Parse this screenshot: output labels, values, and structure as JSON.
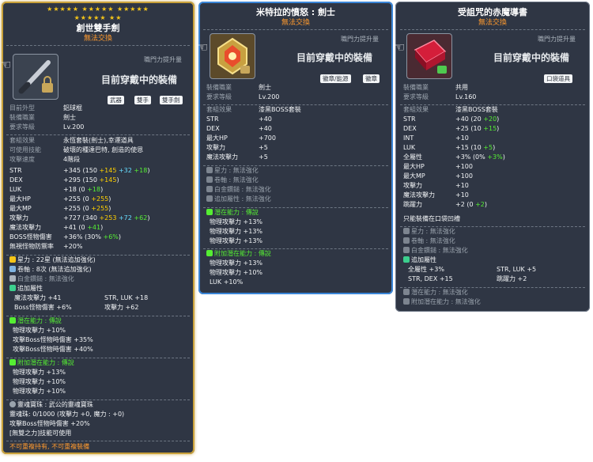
{
  "tip1": {
    "stars_row1": "★★★★★ ★★★★★ ★★★★★",
    "stars_row2": "★★★★★ ★★",
    "title": "創世雙手劍",
    "trade": "無法交換",
    "job_boost": "職門力提升量",
    "equipped": "目前穿戴中的裝備",
    "tags": [
      "武器",
      "雙手",
      "雙手劍"
    ],
    "look_label": "目前外型",
    "look_value": "鋁球棍",
    "job_label": "裝備職業",
    "job_value": "劍士",
    "req_label": "要求等級",
    "req_value": "Lv.200",
    "set_label": "套組效果",
    "set_value": "永恆套裝(劍士),幸運道具",
    "skill_label": "可使用技能",
    "skill_value": "破壞的種達巴特, 創造的使恩",
    "speed_label": "攻擊速度",
    "speed_value": "4階段",
    "stats": [
      {
        "label": "STR",
        "main": "+345 (150 ",
        "a": "+145",
        "b": " +32",
        "c": " +18",
        "end": ")"
      },
      {
        "label": "DEX",
        "main": "+295 (150 ",
        "a": "+145",
        "b": "",
        "c": "",
        "end": ")"
      },
      {
        "label": "LUK",
        "main": "+18 (0 ",
        "a": "",
        "b": "",
        "c": "+18",
        "end": ")"
      },
      {
        "label": "最大HP",
        "main": "+255 (0 ",
        "a": "+255",
        "b": "",
        "c": "",
        "end": ")"
      },
      {
        "label": "最大MP",
        "main": "+255 (0 ",
        "a": "+255",
        "b": "",
        "c": "",
        "end": ")"
      },
      {
        "label": "攻擊力",
        "main": "+727 (340 ",
        "a": "+253",
        "b": " +72",
        "c": " +62",
        "end": ")"
      },
      {
        "label": "魔法攻擊力",
        "main": "+41 (0 ",
        "a": "",
        "b": "",
        "c": "+41",
        "end": ")"
      },
      {
        "label": "BOSS怪物傷害",
        "main": "+36% (30% ",
        "a": "",
        "b": "",
        "c": "+6%",
        "end": ")"
      },
      {
        "label": "無視怪物防禦率",
        "main": "+20%",
        "a": "",
        "b": "",
        "c": "",
        "end": ""
      }
    ],
    "starforce": "星力 : 22星 (無法追加強化)",
    "scroll": "卷軸 : 8次 (無法追加強化)",
    "platinum": "白金鑽鎚 : 無法強化",
    "extra_title": "追加屬性",
    "extra": [
      "魔法攻擊力 +41",
      "STR, LUK   +18",
      "Boss怪物傷害 +6%",
      "攻擊力 +62"
    ],
    "potential_title": "潛在能力 : 傳說",
    "potential": [
      "物理攻擊力 +10%",
      "攻擊Boss怪物時傷害 +35%",
      "攻擊Boss怪物時傷害 +40%"
    ],
    "add_potential_title": "附加潛在能力 : 傳說",
    "add_potential": [
      "物理攻擊力 +13%",
      "物理攻擊力 +10%",
      "物理攻擊力 +10%"
    ],
    "soul_title": "靈魂寶珠 : 武公的靈魂寶珠",
    "soul_charge": "靈魂珠: 0/1000 (攻擊力 +0, 魔力 : +0)",
    "soul_boss": "攻擊Boss怪物時傷害 +20%",
    "soul_skill": "[無雙之力]技能可使用",
    "footer": "不可重複持有, 不可重複裝備"
  },
  "tip2": {
    "title": "米特拉的憤怒 : 劍士",
    "trade": "無法交換",
    "job_boost": "職門力提升量",
    "equipped": "目前穿戴中的裝備",
    "tags": [
      "徽章/能源",
      "徽章"
    ],
    "job_label": "裝備職業",
    "job_value": "劍士",
    "req_label": "要求等級",
    "req_value": "Lv.200",
    "set_label": "套組效果",
    "set_value": "漆黑BOSS套裝",
    "stats": [
      {
        "label": "STR",
        "value": "+40"
      },
      {
        "label": "DEX",
        "value": "+40"
      },
      {
        "label": "最大HP",
        "value": "+700"
      },
      {
        "label": "攻擊力",
        "value": "+5"
      },
      {
        "label": "魔法攻擊力",
        "value": "+5"
      }
    ],
    "starforce": "星力 : 無法強化",
    "scroll": "卷軸 : 無法強化",
    "platinum": "白金鑽鎚 : 無法強化",
    "extra": "追加屬性 : 無法強化",
    "potential_title": "潛在能力 : 傳說",
    "potential": [
      "物理攻擊力 +13%",
      "物理攻擊力 +13%",
      "物理攻擊力 +13%"
    ],
    "add_potential_title": "附加潛在能力 : 傳說",
    "add_potential": [
      "物理攻擊力 +13%",
      "物理攻擊力 +10%",
      "LUK +10%"
    ]
  },
  "tip3": {
    "title": "受詛咒的赤魔導書",
    "trade": "無法交換",
    "job_boost": "職門力提升量",
    "equipped": "目前穿戴中的裝備",
    "tags": [
      "口袋道具"
    ],
    "job_label": "裝備職業",
    "job_value": "共用",
    "req_label": "要求等級",
    "req_value": "Lv.160",
    "set_label": "套組效果",
    "set_value": "漆黑BOSS套裝",
    "stats": [
      {
        "label": "STR",
        "main": "+40 (20 ",
        "c": "+20",
        "end": ")"
      },
      {
        "label": "DEX",
        "main": "+25 (10 ",
        "c": "+15",
        "end": ")"
      },
      {
        "label": "INT",
        "main": "+10",
        "c": "",
        "end": ""
      },
      {
        "label": "LUK",
        "main": "+15 (10 ",
        "c": "+5",
        "end": ")"
      },
      {
        "label": "全屬性",
        "main": "+3% (0% ",
        "c": "+3%",
        "end": ")"
      },
      {
        "label": "最大HP",
        "main": "+100",
        "c": "",
        "end": ""
      },
      {
        "label": "最大MP",
        "main": "+100",
        "c": "",
        "end": ""
      },
      {
        "label": "攻擊力",
        "main": "+10",
        "c": "",
        "end": ""
      },
      {
        "label": "魔法攻擊力",
        "main": "+10",
        "c": "",
        "end": ""
      },
      {
        "label": "跳躍力",
        "main": "+2 (0 ",
        "c": "+2",
        "end": ")"
      }
    ],
    "pocket_only": "只能裝備在口袋凹槽",
    "starforce": "星力 : 無法強化",
    "scroll": "卷軸 : 無法強化",
    "platinum": "白金鑽鎚 : 無法強化",
    "extra_title": "追加屬性",
    "extra": [
      "全屬性 +3%",
      "STR, LUK   +5",
      "STR, DEX   +15",
      "跳躍力 +2"
    ],
    "potential": "潛在能力 : 無法強化",
    "add_potential": "附加潛在能力 : 無法強化"
  }
}
